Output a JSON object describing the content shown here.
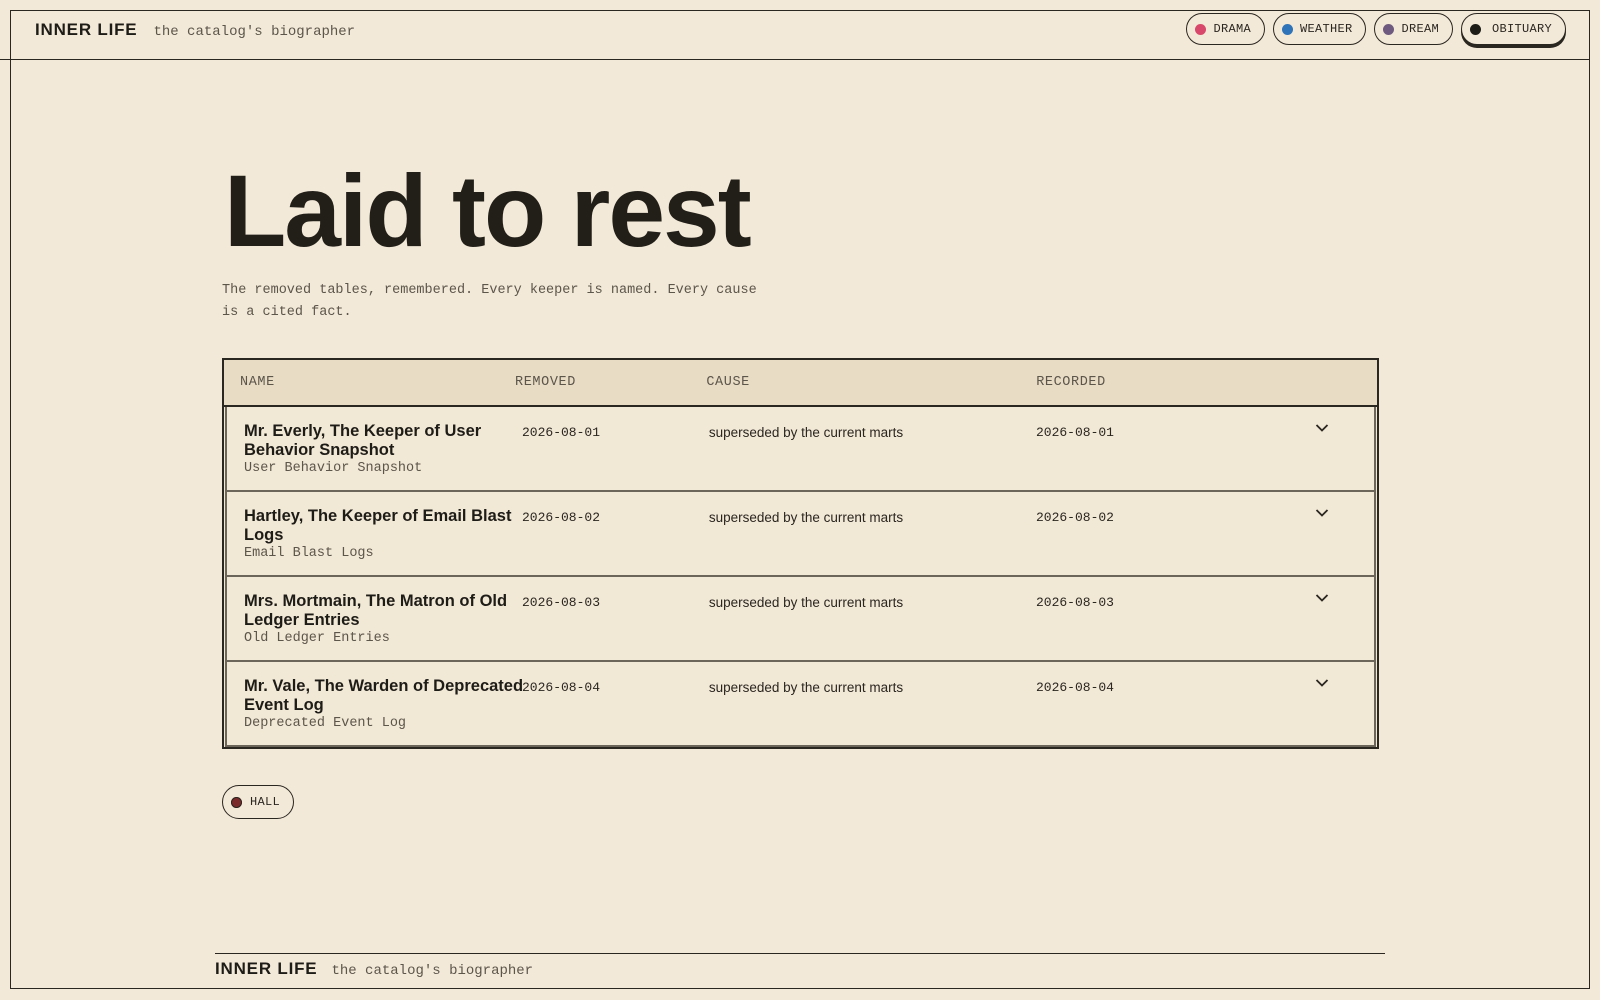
{
  "header": {
    "brand": "INNER LIFE",
    "tagline": "the catalog's biographer",
    "chips": [
      {
        "label": "DRAMA",
        "color": "#d8486a",
        "active": false
      },
      {
        "label": "WEATHER",
        "color": "#2f73b8",
        "active": false
      },
      {
        "label": "DREAM",
        "color": "#6e5a7e",
        "active": false
      },
      {
        "label": "OBITUARY",
        "color": "#1e1c17",
        "active": true
      }
    ]
  },
  "page": {
    "title": "Laid to rest",
    "subtitle": "The removed tables, remembered. Every keeper is named. Every cause is a cited fact."
  },
  "table": {
    "columns": [
      "NAME",
      "REMOVED",
      "CAUSE",
      "RECORDED"
    ],
    "rows": [
      {
        "name": "Mr. Everly, The Keeper of User Behavior Snapshot",
        "subname": "User Behavior Snapshot",
        "removed": "2026-08-01",
        "cause": "superseded by the current marts",
        "recorded": "2026-08-01"
      },
      {
        "name": "Hartley, The Keeper of Email Blast Logs",
        "subname": "Email Blast Logs",
        "removed": "2026-08-02",
        "cause": "superseded by the current marts",
        "recorded": "2026-08-02"
      },
      {
        "name": "Mrs. Mortmain, The Matron of Old Ledger Entries",
        "subname": "Old Ledger Entries",
        "removed": "2026-08-03",
        "cause": "superseded by the current marts",
        "recorded": "2026-08-03"
      },
      {
        "name": "Mr. Vale, The Warden of Deprecated Event Log",
        "subname": "Deprecated Event Log",
        "removed": "2026-08-04",
        "cause": "superseded by the current marts",
        "recorded": "2026-08-04"
      }
    ]
  },
  "hall_button": {
    "label": "HALL",
    "color": "#7a2a2a"
  },
  "footer": {
    "brand": "INNER LIFE",
    "tagline": "the catalog's biographer"
  }
}
